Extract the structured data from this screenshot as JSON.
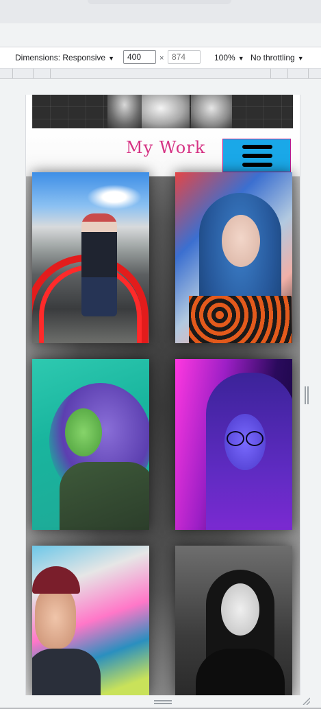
{
  "devtools": {
    "dimensions_label": "Dimensions: Responsive",
    "width_value": "400",
    "times_symbol": "×",
    "height_placeholder": "874",
    "zoom_label": "100%",
    "throttling_label": "No throttling",
    "caret": "▼"
  },
  "page": {
    "title": "My Work",
    "menu_icon": "hamburger-icon",
    "accent_color": "#d63384",
    "menu_button_color": "#1aa8e8"
  },
  "gallery": {
    "photos": [
      {
        "name": "photo-red-sculpture"
      },
      {
        "name": "photo-blue-hair"
      },
      {
        "name": "photo-green-purple"
      },
      {
        "name": "photo-neon-glasses"
      },
      {
        "name": "photo-graffiti-beanie"
      },
      {
        "name": "photo-black-white"
      }
    ]
  }
}
